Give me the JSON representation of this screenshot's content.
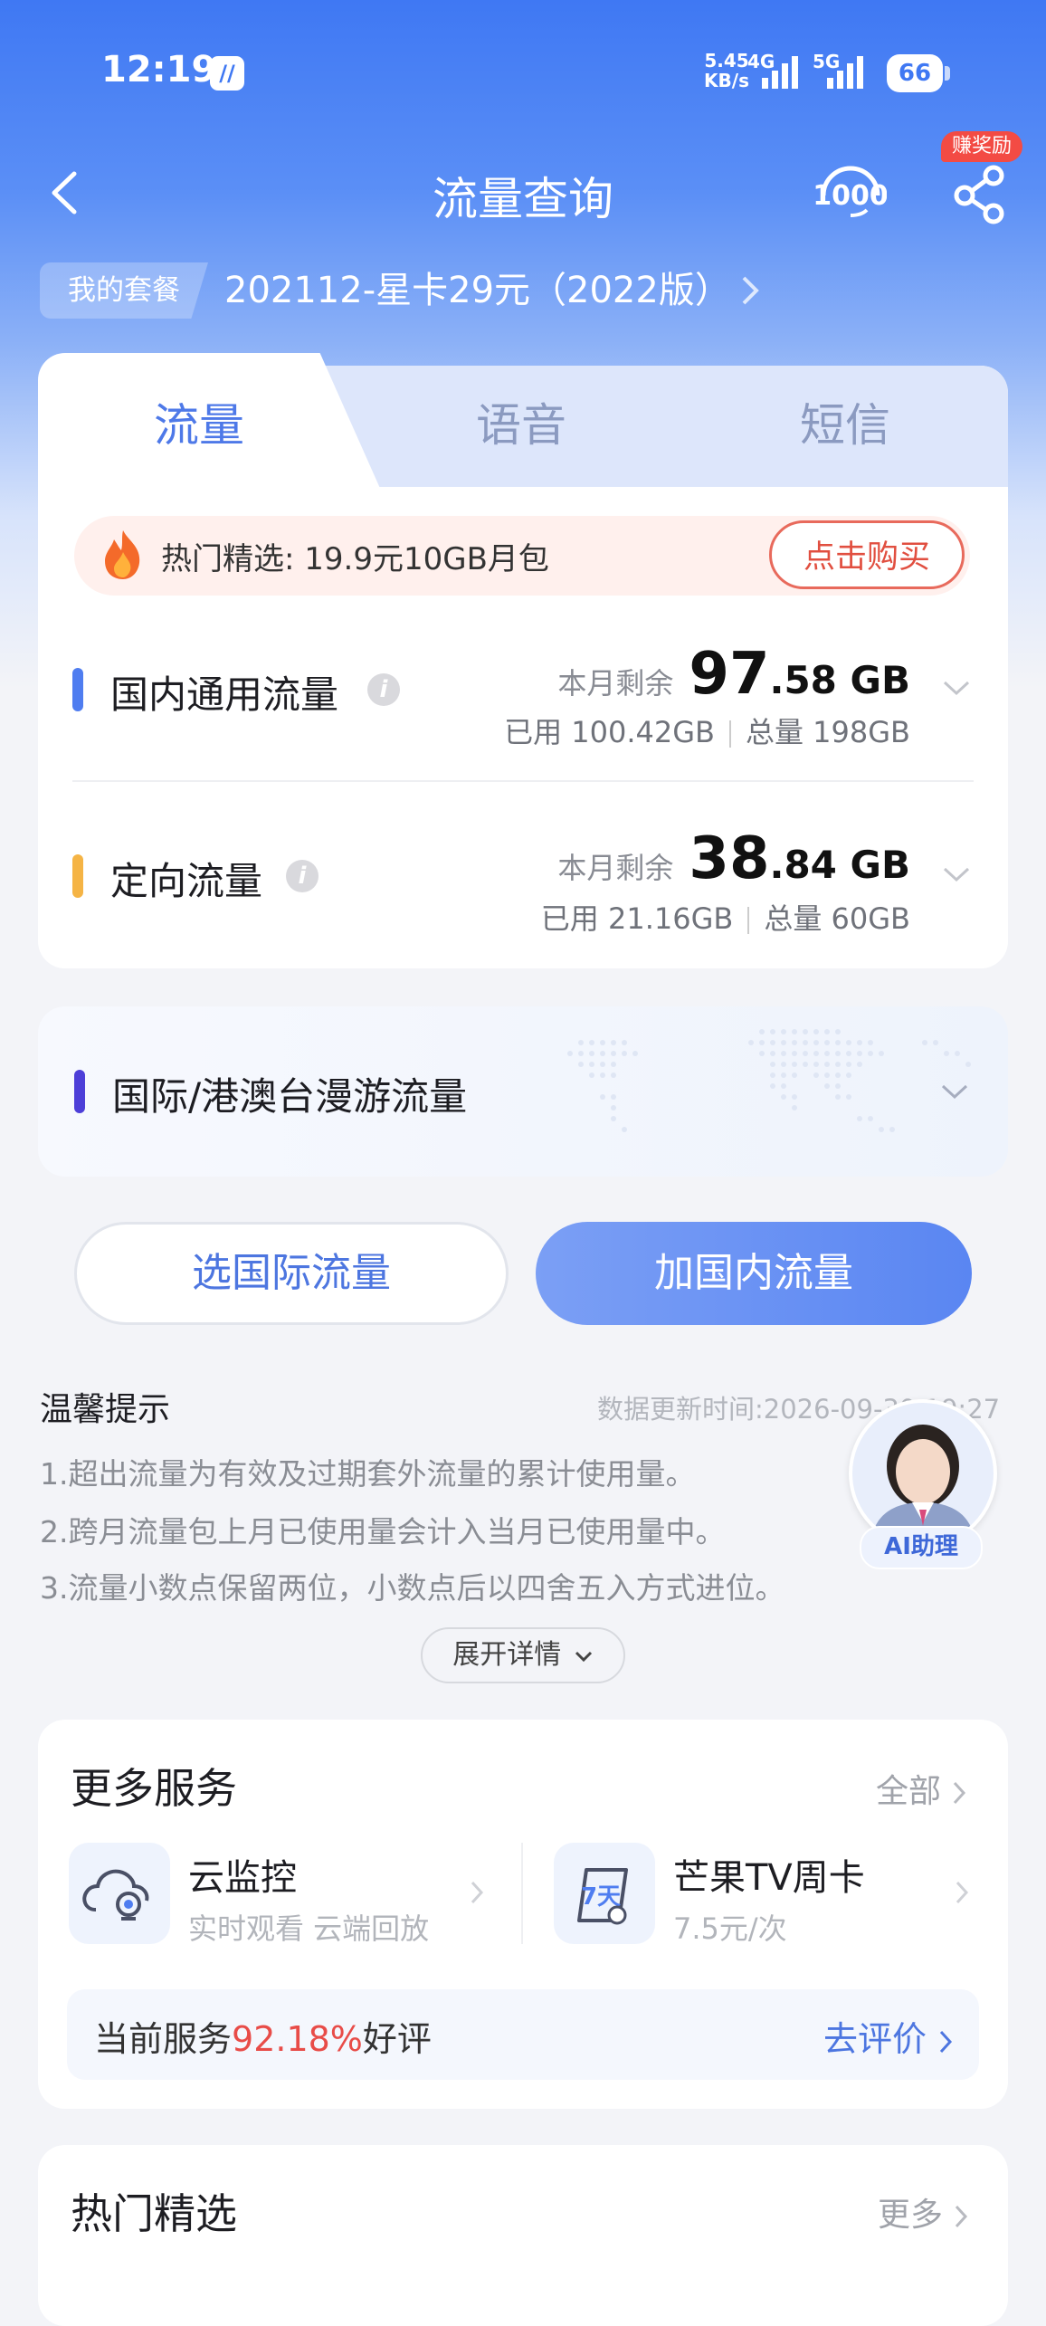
{
  "status_bar": {
    "time": "12:19",
    "speed_value": "5.45",
    "speed_unit": "KB/s",
    "net1": "4G",
    "net2": "5G",
    "battery": "66"
  },
  "header": {
    "title": "流量查询",
    "reward_badge": "赚奖励"
  },
  "plan": {
    "tag": "我的套餐",
    "name": "202112-星卡29元（2022版）"
  },
  "tabs": [
    {
      "label": "流量",
      "active": true
    },
    {
      "label": "语音",
      "active": false
    },
    {
      "label": "短信",
      "active": false
    }
  ],
  "promo": {
    "text": "热门精选: 19.9元10GB月包",
    "button": "点击购买"
  },
  "usage": [
    {
      "label": "国内通用流量",
      "color": "#4f7df0",
      "remain_label": "本月剩余",
      "remain_int": "97",
      "remain_dec": ".58 GB",
      "used": "已用 100.42GB",
      "total": "总量 198GB"
    },
    {
      "label": "定向流量",
      "color": "#f5b445",
      "remain_label": "本月剩余",
      "remain_int": "38",
      "remain_dec": ".84 GB",
      "used": "已用 21.16GB",
      "total": "总量 60GB"
    }
  ],
  "roaming": {
    "label": "国际/港澳台漫游流量",
    "color": "#4d3fd8"
  },
  "actions": {
    "intl": "选国际流量",
    "domestic": "加国内流量"
  },
  "tips": {
    "title": "温馨提示",
    "update_time": "数据更新时间:2026-09-30 19:27",
    "lines": [
      "1.超出流量为有效及过期套外流量的累计使用量。",
      "2.跨月流量包上月已使用量会计入当月已使用量中。",
      "3.流量小数点保留两位，小数点后以四舍五入方式进位。"
    ],
    "expand": "展开详情"
  },
  "assistant": {
    "label": "AI助理"
  },
  "services": {
    "title": "更多服务",
    "all": "全部",
    "items": [
      {
        "name": "云监控",
        "desc": "实时观看 云端回放",
        "icon": "cloud-camera-icon"
      },
      {
        "name": "芒果TV周卡",
        "desc": "7.5元/次",
        "icon": "mango-tv-icon"
      }
    ],
    "rating_prefix": "当前服务",
    "rating_pct": "92.18%",
    "rating_suffix": "好评",
    "rate_link": "去评价"
  },
  "hot": {
    "title": "热门精选",
    "more": "更多"
  }
}
